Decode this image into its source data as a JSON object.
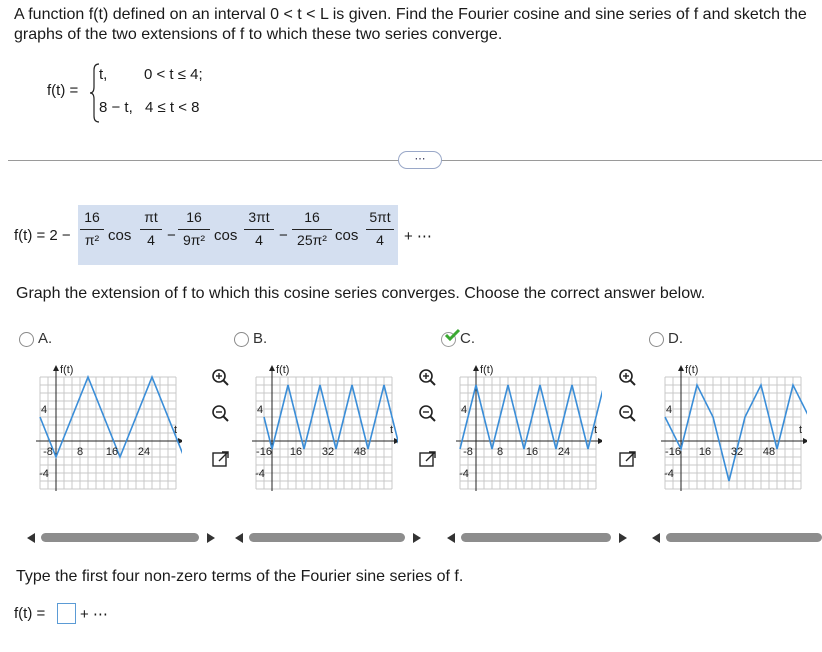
{
  "question": {
    "text": "A function f(t) defined on an interval 0 < t < L is given. Find the Fourier cosine and sine series of f and sketch the graphs of the two extensions of f to which these two series converge.",
    "f_label": "f(t) =",
    "piece1_expr": "t,",
    "piece1_cond": "0 < t ≤ 4;",
    "piece2_expr": "8 − t,",
    "piece2_cond": "4 ≤ t < 8"
  },
  "more_button": "⋯",
  "cosine_series": {
    "lhs": "f(t) = 2 −",
    "t1_num": "16",
    "t1_den": "π²",
    "cos": "cos",
    "t1_arg_num": "πt",
    "t1_arg_den": "4",
    "minus": "−",
    "t2_num": "16",
    "t2_den": "9π²",
    "t2_arg_num": "3πt",
    "t2_arg_den": "4",
    "t3_num": "16",
    "t3_den": "25π²",
    "t3_arg_num": "5πt",
    "t3_arg_den": "4",
    "tail": "+ ⋯"
  },
  "prompt": "Graph the extension of f to which this cosine series converges. Choose the correct answer below.",
  "options": [
    {
      "label": "A.",
      "xticks": [
        "-8",
        "8",
        "16",
        "24"
      ],
      "y_label": "f(t)",
      "t_label": "t",
      "y_ticks": [
        "4",
        "-4"
      ]
    },
    {
      "label": "B.",
      "xticks": [
        "-16",
        "16",
        "32",
        "48"
      ],
      "y_label": "f(t)",
      "t_label": "t",
      "y_ticks": [
        "4",
        "-4"
      ]
    },
    {
      "label": "C.",
      "xticks": [
        "-8",
        "8",
        "16",
        "24"
      ],
      "y_label": "f(t)",
      "t_label": "t",
      "y_ticks": [
        "4",
        "-4"
      ],
      "selected": true
    },
    {
      "label": "D.",
      "xticks": [
        "-16",
        "16",
        "32",
        "48"
      ],
      "y_label": "f(t)",
      "t_label": "t",
      "y_ticks": [
        "4",
        "-4"
      ]
    }
  ],
  "tools": [
    "zoom-in-icon",
    "zoom-out-icon",
    "expand-icon"
  ],
  "sine_prompt": "Type the first four non-zero terms of the Fourier sine series of f.",
  "sine_answer": {
    "lhs": "f(t) =",
    "value": "",
    "tail": "+ ⋯"
  },
  "colors": {
    "highlight": "#d4dff0",
    "graph_line": "#3b8ed8",
    "check": "#3aa832"
  }
}
